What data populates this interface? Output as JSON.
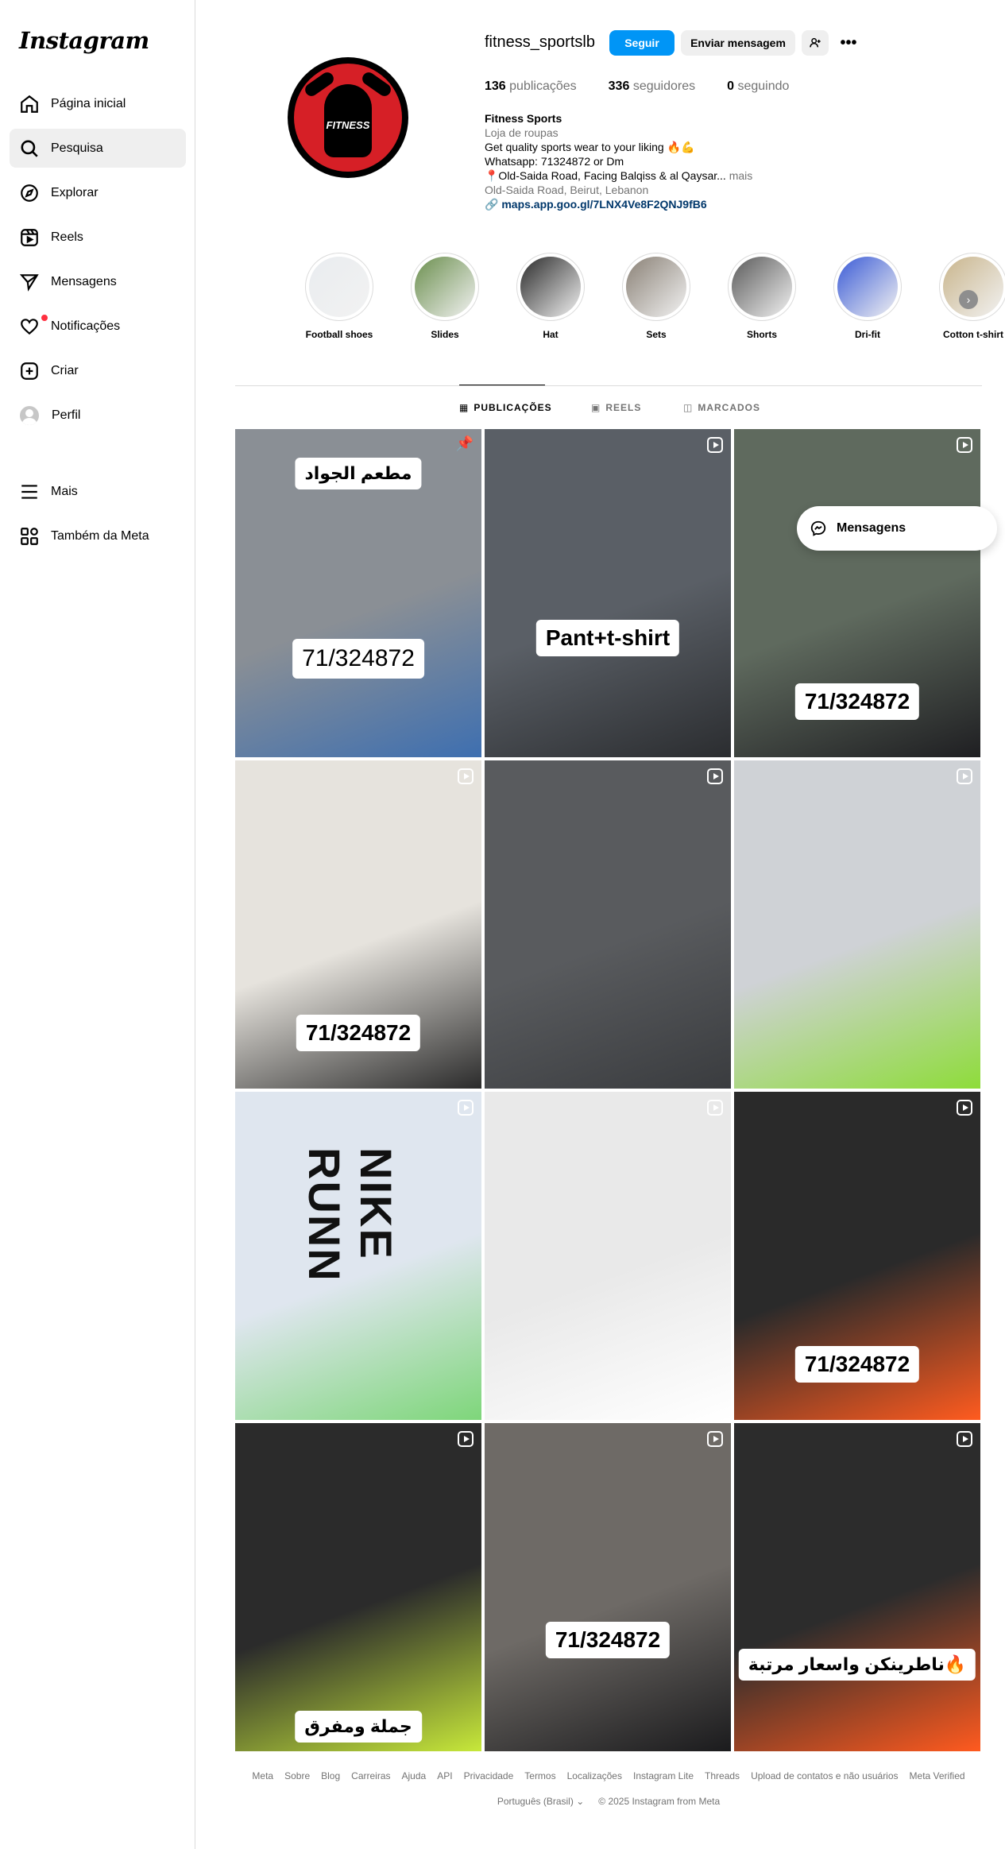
{
  "brand": {
    "logo": "Instagram"
  },
  "sidebar": {
    "items": [
      {
        "label": "Página inicial",
        "icon": "home-icon"
      },
      {
        "label": "Pesquisa",
        "icon": "search-icon"
      },
      {
        "label": "Explorar",
        "icon": "compass-icon"
      },
      {
        "label": "Reels",
        "icon": "reels-icon"
      },
      {
        "label": "Mensagens",
        "icon": "send-icon"
      },
      {
        "label": "Notificações",
        "icon": "heart-icon"
      },
      {
        "label": "Criar",
        "icon": "plus-square-icon"
      },
      {
        "label": "Perfil",
        "icon": "avatar"
      }
    ],
    "more": "Mais",
    "meta": "Também da Meta",
    "active_index": 1
  },
  "profile": {
    "username": "fitness_sportslb",
    "logo_text": "FITNESS",
    "follow_label": "Seguir",
    "message_label": "Enviar mensagem",
    "stats": {
      "posts_count": "136",
      "posts_label": "publicações",
      "followers_count": "336",
      "followers_label": "seguidores",
      "following_count": "0",
      "following_label": "seguindo"
    },
    "bio": {
      "name": "Fitness Sports",
      "category": "Loja de roupas",
      "line1": "Get quality sports wear to your liking 🔥💪",
      "line2": "Whatsapp: 71324872 or Dm",
      "line3": "📍Old-Saida Road, Facing Balqiss & al Qaysar...",
      "more": "mais",
      "address": "Old-Saida Road, Beirut, Lebanon",
      "link": "maps.app.goo.gl/7LNX4Ve8F2QNJ9fB6"
    }
  },
  "highlights": [
    {
      "label": "Football shoes",
      "color": "#e9ecef"
    },
    {
      "label": "Slides",
      "color": "#6b8f4e"
    },
    {
      "label": "Hat",
      "color": "#2a2a2a"
    },
    {
      "label": "Sets",
      "color": "#8a8176"
    },
    {
      "label": "Shorts",
      "color": "#5a5a5a"
    },
    {
      "label": "Dri-fit",
      "color": "#3b5bd6"
    },
    {
      "label": "Cotton t-shirt",
      "color": "#c9b58c"
    }
  ],
  "tabs": [
    {
      "label": "PUBLICAÇÕES",
      "icon": "grid-icon"
    },
    {
      "label": "REELS",
      "icon": "reels-icon"
    },
    {
      "label": "MARCADOS",
      "icon": "tagged-icon"
    }
  ],
  "posts": [
    {
      "overlay": "مطعم الجواد",
      "overlay2": "71/324872",
      "bg": "#8a8f95",
      "bg2": "#3e6fb0",
      "pinned": true
    },
    {
      "overlay": "Pant+t-shirt",
      "bg": "#5a5f66",
      "bg2": "#2b2d30"
    },
    {
      "overlay": "71/324872",
      "bg": "#5f6a5e",
      "bg2": "#1f1f22"
    },
    {
      "overlay": "71/324872",
      "bg": "#e6e3dd",
      "bg2": "#2b2b2b"
    },
    {
      "overlay": "",
      "bg": "#595b5e",
      "bg2": "#3a3c3f"
    },
    {
      "overlay": "",
      "bg": "#cfd2d6",
      "bg2": "#8edc3a"
    },
    {
      "overlay": "NIKE RUNN",
      "bg": "#dfe6ef",
      "bg2": "#7ed67a"
    },
    {
      "overlay": "",
      "bg": "#e9e9e9",
      "bg2": "#ffffff"
    },
    {
      "overlay": "71/324872",
      "bg": "#2a2a2a",
      "bg2": "#ff5b1f"
    },
    {
      "overlay": "جملة ومفرق",
      "bg": "#2b2b2b",
      "bg2": "#c7e83a"
    },
    {
      "overlay": "71/324872",
      "bg": "#6e6a66",
      "bg2": "#1b1b1d"
    },
    {
      "overlay": "ناطرينكن واسعار مرتبة🔥",
      "bg": "#2c2c2c",
      "bg2": "#ff5a1f"
    }
  ],
  "floating": {
    "messages_label": "Mensagens"
  },
  "footer": {
    "links": [
      "Meta",
      "Sobre",
      "Blog",
      "Carreiras",
      "Ajuda",
      "API",
      "Privacidade",
      "Termos",
      "Localizações",
      "Instagram Lite",
      "Threads",
      "Upload de contatos e não usuários",
      "Meta Verified"
    ],
    "language": "Português (Brasil)",
    "copyright": "© 2025 Instagram from Meta"
  }
}
